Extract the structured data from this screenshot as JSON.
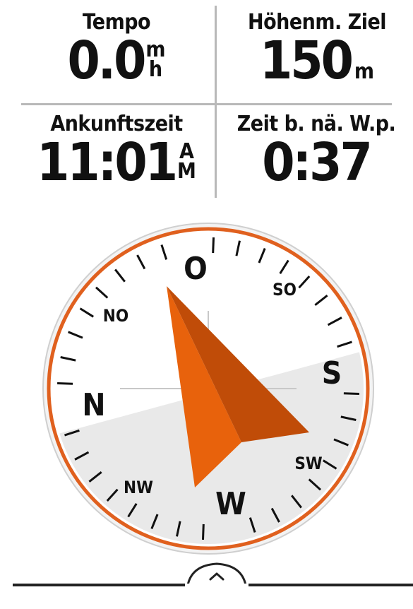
{
  "fields": {
    "top_left": {
      "label": "Tempo",
      "value": "0.0",
      "unit_top": "m",
      "unit_bottom": "h"
    },
    "top_right": {
      "label": "Höhenm. Ziel",
      "value": "150",
      "unit": "m"
    },
    "bottom_left": {
      "label": "Ankunftszeit",
      "value": "11:01",
      "unit_top": "A",
      "unit_bottom": "M"
    },
    "bottom_right": {
      "label": "Zeit b. nä. W.p.",
      "value": "0:37"
    }
  },
  "compass": {
    "cardinals": {
      "north": "N",
      "east": "O",
      "south": "S",
      "west": "W"
    },
    "intercardinals": {
      "ne": "NO",
      "se": "SO",
      "sw": "SW",
      "nw": "NW"
    },
    "ring_color": "#e0601e",
    "pointer_color": "#e8620c",
    "pointer_shadow_color": "#bf4a06"
  },
  "footer": {
    "handle_icon": "chevron-up-icon"
  }
}
